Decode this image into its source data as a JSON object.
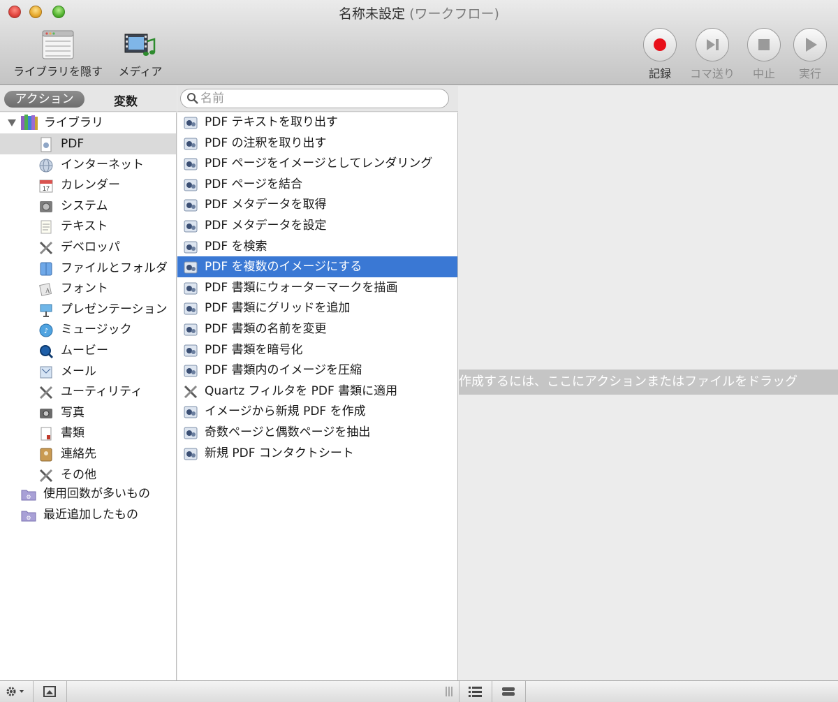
{
  "window": {
    "title_main": "名称未設定",
    "title_suffix": "(ワークフロー)"
  },
  "toolbar": {
    "library_label": "ライブラリを隠す",
    "media_label": "メディア",
    "record_label": "記録",
    "step_label": "コマ送り",
    "stop_label": "中止",
    "run_label": "実行"
  },
  "left_header": {
    "actions_tab": "アクション",
    "variables_tab": "変数"
  },
  "search": {
    "placeholder": "名前"
  },
  "library": {
    "root_label": "ライブラリ",
    "items": [
      {
        "label": "PDF",
        "icon": "pdf-icon",
        "selected": true
      },
      {
        "label": "インターネット",
        "icon": "internet-icon"
      },
      {
        "label": "カレンダー",
        "icon": "calendar-icon"
      },
      {
        "label": "システム",
        "icon": "system-icon"
      },
      {
        "label": "テキスト",
        "icon": "text-icon"
      },
      {
        "label": "デベロッパ",
        "icon": "developer-icon"
      },
      {
        "label": "ファイルとフォルダ",
        "icon": "finder-icon"
      },
      {
        "label": "フォント",
        "icon": "font-icon"
      },
      {
        "label": "プレゼンテーション",
        "icon": "keynote-icon"
      },
      {
        "label": "ミュージック",
        "icon": "music-icon"
      },
      {
        "label": "ムービー",
        "icon": "movie-icon"
      },
      {
        "label": "メール",
        "icon": "mail-icon"
      },
      {
        "label": "ユーティリティ",
        "icon": "utility-icon"
      },
      {
        "label": "写真",
        "icon": "photo-icon"
      },
      {
        "label": "書類",
        "icon": "document-icon"
      },
      {
        "label": "連絡先",
        "icon": "contacts-icon"
      },
      {
        "label": "その他",
        "icon": "other-icon"
      }
    ],
    "smart_groups": [
      {
        "label": "使用回数が多いもの",
        "icon": "smart-folder-icon"
      },
      {
        "label": "最近追加したもの",
        "icon": "smart-folder-icon"
      }
    ]
  },
  "actions": [
    {
      "label": "PDF テキストを取り出す"
    },
    {
      "label": "PDF の注釈を取り出す"
    },
    {
      "label": "PDF ページをイメージとしてレンダリング"
    },
    {
      "label": "PDF ページを結合"
    },
    {
      "label": "PDF メタデータを取得"
    },
    {
      "label": "PDF メタデータを設定"
    },
    {
      "label": "PDF を検索"
    },
    {
      "label": "PDF を複数のイメージにする",
      "selected": true
    },
    {
      "label": "PDF 書類にウォーターマークを描画"
    },
    {
      "label": "PDF 書類にグリッドを追加"
    },
    {
      "label": "PDF 書類の名前を変更"
    },
    {
      "label": "PDF 書類を暗号化"
    },
    {
      "label": "PDF 書類内のイメージを圧縮"
    },
    {
      "label": "Quartz フィルタを PDF 書類に適用",
      "icon": "utility-icon"
    },
    {
      "label": "イメージから新規 PDF を作成"
    },
    {
      "label": "奇数ページと偶数ページを抽出"
    },
    {
      "label": "新規 PDF コンタクトシート"
    }
  ],
  "workflow": {
    "hint": "作成するには、ここにアクションまたはファイルをドラッグ"
  },
  "colors": {
    "selection_blue": "#3a78d4",
    "record_red": "#e8101a"
  }
}
